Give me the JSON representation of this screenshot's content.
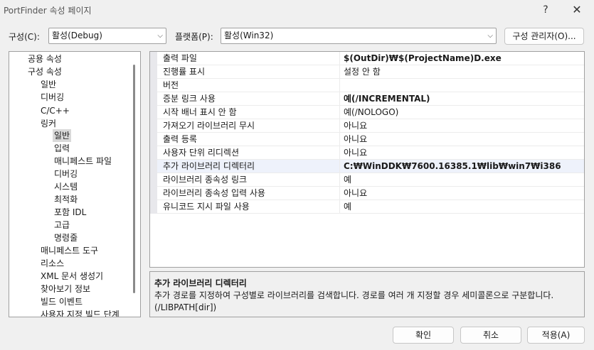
{
  "window": {
    "title": "PortFinder 속성 페이지",
    "help": "?",
    "close": "✕"
  },
  "config": {
    "label": "구성(C):",
    "value": "활성(Debug)"
  },
  "platform": {
    "label": "플랫폼(P):",
    "value": "활성(Win32)"
  },
  "config_manager": "구성 관리자(O)...",
  "tree": [
    "공용 속성",
    "구성 속성",
    "일반",
    "디버깅",
    "C/C++",
    "링커",
    "일반",
    "입력",
    "매니페스트 파일",
    "디버깅",
    "시스템",
    "최적화",
    "포함 IDL",
    "고급",
    "명령줄",
    "매니페스트 도구",
    "리소스",
    "XML 문서 생성기",
    "찾아보기 정보",
    "빌드 이벤트",
    "사용자 지정 빌드 단계"
  ],
  "grid": [
    {
      "name": "출력 파일",
      "value": "$(OutDir)₩$(ProjectName)D.exe"
    },
    {
      "name": "진행률 표시",
      "value": "설정 안 함"
    },
    {
      "name": "버전",
      "value": ""
    },
    {
      "name": "증분 링크 사용",
      "value": "예(/INCREMENTAL)"
    },
    {
      "name": "시작 배너 표시 안 함",
      "value": "예(/NOLOGO)"
    },
    {
      "name": "가져오기 라이브러리 무시",
      "value": "아니요"
    },
    {
      "name": "출력 등록",
      "value": "아니요"
    },
    {
      "name": "사용자 단위 리디렉션",
      "value": "아니요"
    },
    {
      "name": "추가 라이브러리 디렉터리",
      "value": "C:₩WinDDK₩7600.16385.1₩lib₩win7₩i386"
    },
    {
      "name": "라이브러리 종속성 링크",
      "value": "예"
    },
    {
      "name": "라이브러리 종속성 입력 사용",
      "value": "아니요"
    },
    {
      "name": "유니코드 지시 파일 사용",
      "value": "예"
    }
  ],
  "description": {
    "title": "추가 라이브러리 디렉터리",
    "text": "추가 경로를 지정하여 구성별로 라이브러리를 검색합니다. 경로를 여러 개 지정할 경우 세미콜론으로 구분합니다.     (/LIBPATH[dir])"
  },
  "buttons": {
    "ok": "확인",
    "cancel": "취소",
    "apply": "적용(A)"
  }
}
